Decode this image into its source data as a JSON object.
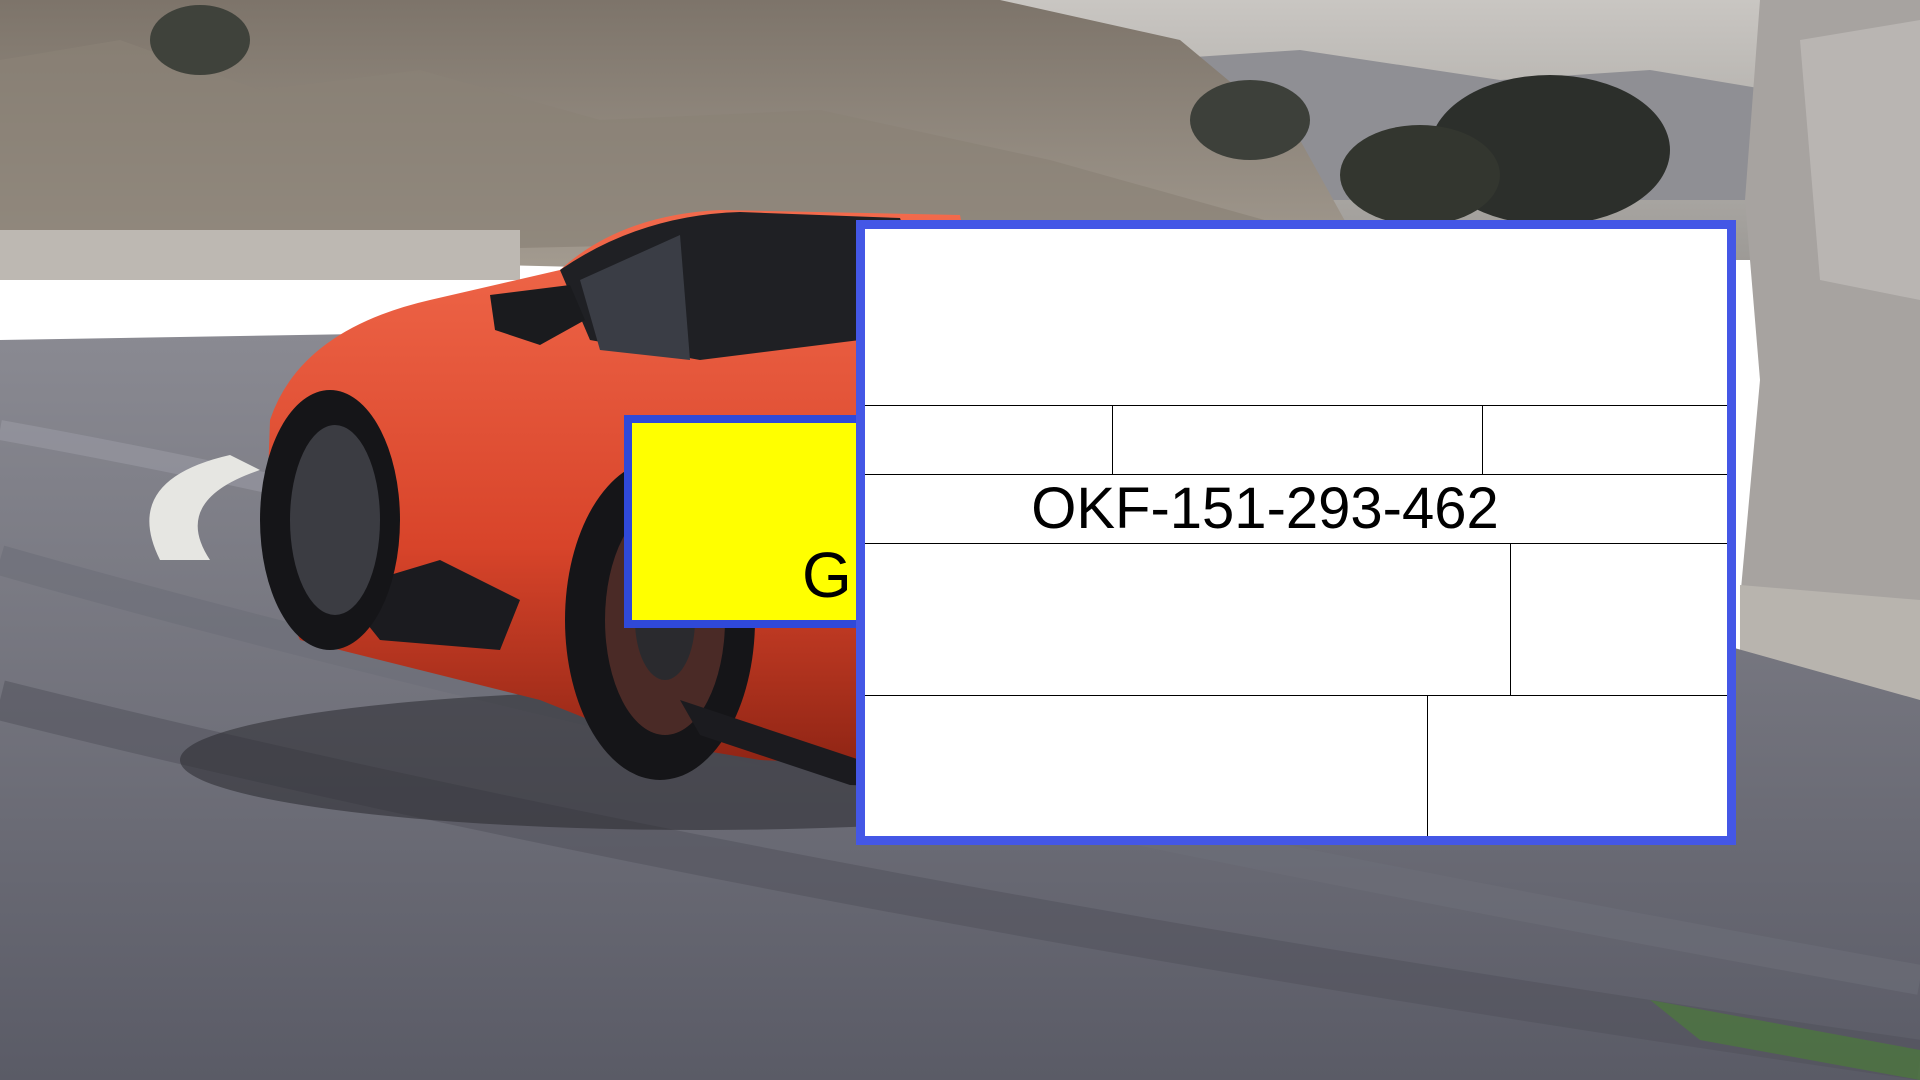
{
  "background": {
    "description_icon": "sports-car-photo"
  },
  "yellow_panel": {
    "label": "G",
    "fill_color": "#ffff00",
    "border_color": "#2f49d9"
  },
  "form_panel": {
    "serial_number": "OKF-151-293-462",
    "border_color": "#4457e6"
  }
}
